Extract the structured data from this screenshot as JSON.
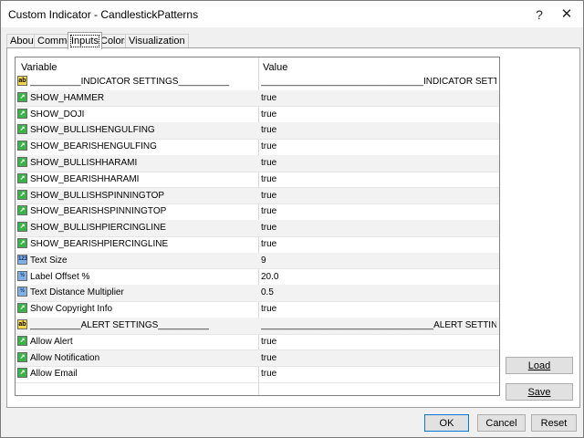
{
  "window": {
    "title": "Custom Indicator - CandlestickPatterns",
    "help_glyph": "?",
    "close_glyph": "✕"
  },
  "tabs": [
    {
      "label": "About",
      "active": false
    },
    {
      "label": "Common",
      "active": false
    },
    {
      "label": "Inputs",
      "active": true
    },
    {
      "label": "Colors",
      "active": false
    },
    {
      "label": "Visualization",
      "active": false
    }
  ],
  "grid": {
    "col_variable": "Variable",
    "col_value": "Value",
    "rows": [
      {
        "icon": "ab-string-icon",
        "variable": "__________INDICATOR SETTINGS__________",
        "value": "________________________________INDICATOR SETTINGS______..."
      },
      {
        "icon": "line-bool-icon",
        "variable": "SHOW_HAMMER",
        "value": "true"
      },
      {
        "icon": "line-bool-icon",
        "variable": "SHOW_DOJI",
        "value": "true"
      },
      {
        "icon": "line-bool-icon",
        "variable": "SHOW_BULLISHENGULFING",
        "value": "true"
      },
      {
        "icon": "line-bool-icon",
        "variable": "SHOW_BEARISHENGULFING",
        "value": "true"
      },
      {
        "icon": "line-bool-icon",
        "variable": "SHOW_BULLISHHARAMI",
        "value": "true"
      },
      {
        "icon": "line-bool-icon",
        "variable": "SHOW_BEARISHHARAMI",
        "value": "true"
      },
      {
        "icon": "line-bool-icon",
        "variable": "SHOW_BULLISHSPINNINGTOP",
        "value": "true"
      },
      {
        "icon": "line-bool-icon",
        "variable": "SHOW_BEARISHSPINNINGTOP",
        "value": "true"
      },
      {
        "icon": "line-bool-icon",
        "variable": "SHOW_BULLISHPIERCINGLINE",
        "value": "true"
      },
      {
        "icon": "line-bool-icon",
        "variable": "SHOW_BEARISHPIERCINGLINE",
        "value": "true"
      },
      {
        "icon": "int-icon",
        "variable": "Text Size",
        "value": "9"
      },
      {
        "icon": "double-icon",
        "variable": "Label Offset %",
        "value": "20.0"
      },
      {
        "icon": "double-icon",
        "variable": "Text Distance Multiplier",
        "value": "0.5"
      },
      {
        "icon": "line-bool-icon",
        "variable": "Show Copyright Info",
        "value": "true"
      },
      {
        "icon": "ab-string-icon",
        "variable": "__________ALERT SETTINGS__________",
        "value": "__________________________________ALERT SETTINGS_____________"
      },
      {
        "icon": "line-bool-icon",
        "variable": "Allow Alert",
        "value": "true"
      },
      {
        "icon": "line-bool-icon",
        "variable": "Allow Notification",
        "value": "true"
      },
      {
        "icon": "line-bool-icon",
        "variable": "Allow Email",
        "value": "true"
      }
    ]
  },
  "buttons": {
    "load": "Load",
    "save": "Save",
    "ok": "OK",
    "cancel": "Cancel",
    "reset": "Reset"
  },
  "icon_glyphs": {
    "ab-string-icon": "ab",
    "line-bool-icon": "↗",
    "int-icon": "123",
    "double-icon": "½"
  }
}
